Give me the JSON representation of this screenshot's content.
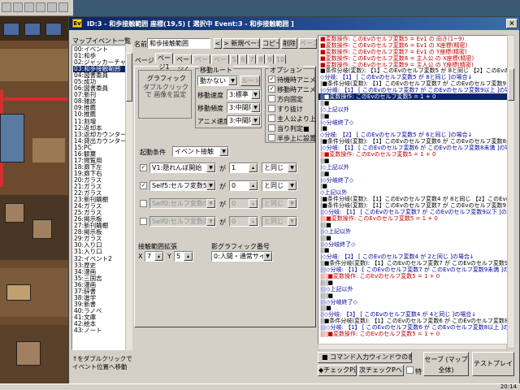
{
  "window": {
    "title": "ID:3 - 和歩接触範囲 座標(19,5) [ 選択中 Event:3 - 和歩接触範囲 ]",
    "icon_label": "Ev",
    "close_label": "×"
  },
  "event_list": {
    "header": "マップイベント一覧",
    "selected_index": 3,
    "items": [
      "00:イベント",
      "01:和歩",
      "02:ジャッカーチャンス",
      "03:和歩接触範囲",
      "04:図書委員",
      "05:成功",
      "06:図書委員",
      "07:新刊",
      "08:雑誌",
      "09:推薦",
      "10:推薦",
      "11:割増",
      "12:返却本",
      "13:返却カウンター",
      "14:貸出カウンター",
      "15:PC",
      "16:観葉",
      "17:閲覧用",
      "18:廊下左",
      "19:廊下右",
      "20:ガラス",
      "21:ガラス",
      "22:ガラス",
      "23:新刊購棚",
      "24:ガラス",
      "25:ガラス",
      "26:掲示板",
      "27:新刊購棚",
      "28:掲示板",
      "29:ガラス",
      "30:入り口",
      "31:入り口",
      "32:イベント2",
      "33:歴史",
      "34:漫画",
      "35:三国志",
      "36:漫画",
      "37:辞書",
      "38:進学",
      "39:新書",
      "40:ラノベ",
      "41:文庫",
      "42:絵本",
      "43:ノート"
    ],
    "hint": "↑をダブルクリックで イベント位置へ移動"
  },
  "panel": {
    "name_label": "名前",
    "name_value": "和歩接触範囲",
    "prev_page_button": "<",
    "new_page_button": "> 新規ページ",
    "copy_button": "コピー",
    "delete_button": "削除",
    "paste_button": "ペースト",
    "page_label": "ページ",
    "tabs": [
      "ページ1",
      "ページ2",
      "ページ3",
      "ページ4",
      "5",
      "6",
      "7",
      "8",
      "9",
      "10"
    ],
    "graphic_label": "グラフィック",
    "graphic_hint": "ダブルクリックで 画像を設定",
    "move_route_label": "移動ルート",
    "move_type": "動かない",
    "route_button": "ルート",
    "move_speed_label": "移動速度",
    "move_speed": "3:標準",
    "move_freq_label": "移動頻度",
    "move_freq": "3:中間隔",
    "anime_speed_label": "アニメ速度",
    "anime_speed": "3:中間隔",
    "options_label": "オプション",
    "options": [
      {
        "label": "待機時アニメ",
        "checked": true
      },
      {
        "label": "移動時アニメ",
        "checked": true
      },
      {
        "label": "方向固定",
        "checked": false
      },
      {
        "label": "すり抜け",
        "checked": false
      },
      {
        "label": "主人公より上",
        "checked": false
      },
      {
        "label": "当り判定■",
        "checked": false
      },
      {
        "label": "半歩上に設置",
        "checked": false
      }
    ],
    "start_cond_label": "起動条件",
    "start_cond": "イベント接触",
    "conditions": [
      {
        "checked": true,
        "var": "V1:隠れんぼ開始",
        "op_label": "が",
        "value": "1",
        "cmp": "と同じ",
        "enabled": true
      },
      {
        "checked": true,
        "var": "Self5:セルフ変数5",
        "op_label": "が",
        "value": "0",
        "cmp": "と同じ",
        "enabled": true
      },
      {
        "checked": false,
        "var": "Self0:セルフ変数0",
        "op_label": "が",
        "value": "0",
        "cmp": "と同じ",
        "enabled": false
      },
      {
        "checked": false,
        "var": "Self0:セルフ変数0",
        "op_label": "が",
        "value": "0",
        "cmp": "と同じ",
        "enabled": false
      }
    ],
    "range_label": "接触範囲拡張",
    "range_x_label": "X",
    "range_x": "7",
    "range_y_label": "Y",
    "range_y": "5",
    "shadow_label": "影グラフィック番号",
    "shadow_value": "0:人間・通常サイズ"
  },
  "script_lines": [
    {
      "text": "■変数操作: このEvのセルフ変数5 = Ev1 の 向き(1~9)",
      "style": "red"
    },
    {
      "text": "■変数操作: このEvのセルフ変数6 = Ev1 の X座標(精密)",
      "style": "red"
    },
    {
      "text": "■変数操作: このEvのセルフ変数7 = Ev1 の Y座標(精密)",
      "style": "red"
    },
    {
      "text": "■変数操作: このEvのセルフ変数8 = 主人公 の X座標(精密)",
      "style": "red"
    },
    {
      "text": "■変数操作: このEvのセルフ変数9 = 主人公 の Y座標(精密)",
      "style": "red"
    },
    {
      "text": "■条件分岐(変数): 【1】このEvのセルフ変数5 が 8と同じ 【2】このEvのセルフ",
      "style": ""
    },
    {
      "text": "◇分岐: 【1】 [ このEvのセルフ変数5 が 8と同じ ]の場合↓",
      "style": "blue"
    },
    {
      "text": "|■条件分岐(変数): 【1】このEvのセルフ変数7 が このEvのセルフ変数9以上",
      "style": ""
    },
    {
      "text": "|◇分岐: 【1】 [ このEvのセルフ変数7 が このEvのセルフ変数9以上 ]の場合↓",
      "style": "blue"
    },
    {
      "text": "||■変数操作: このEvのセルフ変数5 = 1 + 0",
      "style": "sel"
    },
    {
      "text": "||■",
      "style": ""
    },
    {
      "text": "|◇上記以外",
      "style": "blue"
    },
    {
      "text": "||■",
      "style": ""
    },
    {
      "text": "|◇分岐終了◇",
      "style": "blue"
    },
    {
      "text": "|■",
      "style": ""
    },
    {
      "text": "◇分岐: 【2】 [ このEvのセルフ変数5 が 6と同じ ]の場合↓",
      "style": "blue"
    },
    {
      "text": "|■条件分岐(変数): 【1】このEvのセルフ変数6 が このEvのセルフ変数8未満",
      "style": ""
    },
    {
      "text": "|◇分岐: 【1】 [ このEvのセルフ変数6 が このEvのセルフ変数8未満 ]の場合↓",
      "style": "blue"
    },
    {
      "text": "||■変数操作: このEvのセルフ変数5 = 1 + 0",
      "style": "red"
    },
    {
      "text": "||■",
      "style": ""
    },
    {
      "text": "|◇上記以外",
      "style": "blue"
    },
    {
      "text": "||■",
      "style": ""
    },
    {
      "text": "|◇分岐終了◇",
      "style": "blue"
    },
    {
      "text": "|■",
      "style": ""
    },
    {
      "text": "◇上記以外",
      "style": "blue"
    },
    {
      "text": "|■条件分岐(変数): 【1】このEvのセルフ変数4 が 8と同じ 【2】このEvのセルフ",
      "style": ""
    },
    {
      "text": "|■条件分岐(変数): 【1】このEvのセルフ変数7 が このEvのセルフ変数9以下",
      "style": ""
    },
    {
      "text": "||◇分岐: 【1】 [ このEvのセルフ変数7 が このEvのセルフ変数9以下 ]の場合↓",
      "style": "blue"
    },
    {
      "text": "|||■変数操作: このEvのセルフ変数5 = 1 + 0",
      "style": "red"
    },
    {
      "text": "|||■",
      "style": ""
    },
    {
      "text": "||◇上記以外",
      "style": "blue"
    },
    {
      "text": "|||■",
      "style": ""
    },
    {
      "text": "||◇分岐終了◇",
      "style": "blue"
    },
    {
      "text": "||■",
      "style": ""
    },
    {
      "text": "|◇分岐: 【2】 [ このEvのセルフ変数4 が 2と同じ ]の場合↓",
      "style": "blue"
    },
    {
      "text": "||■条件分岐(変数): 【1】このEvのセルフ変数7 が このEvのセルフ変数9未満",
      "style": ""
    },
    {
      "text": "|||◇分岐: 【1】 [ このEvのセルフ変数7 が このEvのセルフ変数9未満 ]の場合↓",
      "style": "blue"
    },
    {
      "text": "||||■変数操作: このEvのセルフ変数5 = 1 + 0",
      "style": "red"
    },
    {
      "text": "||||■",
      "style": ""
    },
    {
      "text": "|||◇上記以外",
      "style": "blue"
    },
    {
      "text": "||||■",
      "style": ""
    },
    {
      "text": "|||◇分岐終了◇",
      "style": "blue"
    },
    {
      "text": "|||■",
      "style": ""
    },
    {
      "text": "||◇分岐: 【3】 [ このEvのセルフ変数4 が 4と同じ ]の場合↓",
      "style": "blue"
    },
    {
      "text": "||■条件分岐(変数): 【1】このEvのセルフ変数6 が このEvのセルフ変数8以上",
      "style": ""
    },
    {
      "text": "|||◇分岐: 【1】 [ このEvのセルフ変数6 が このEvのセルフ変数8以上 ]の場合↓",
      "style": "blue"
    },
    {
      "text": "||||■変数操作: このEvのセルフ変数5 = 1 + 0",
      "style": "red"
    }
  ],
  "bottom": {
    "command_input_button": "■ コマンド入力ウィンドウの表示",
    "save_button": "セーブ (マップ全体)",
    "test_play_button": "テストプレイ",
    "checkpoint_add_button": "◆チェックP追加",
    "checkpoint_next_button": "次チェックPへジャンプ",
    "special_checkbox_label": "特"
  },
  "taskbar": {
    "clock": "20:14"
  }
}
